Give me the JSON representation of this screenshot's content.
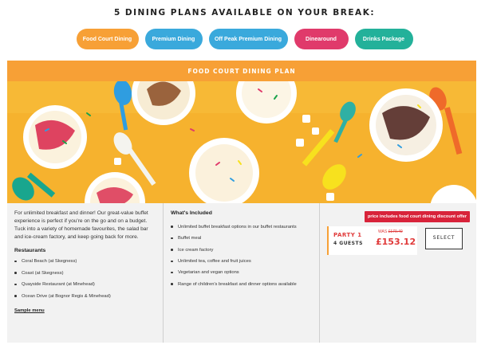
{
  "heading": "5 DINING PLANS AVAILABLE ON YOUR BREAK:",
  "plans": [
    {
      "label": "Food Court Dining",
      "color": "#f7a036"
    },
    {
      "label": "Premium Dining",
      "color": "#3aa9dc"
    },
    {
      "label": "Off Peak Premium Dining",
      "color": "#3aa9dc"
    },
    {
      "label": "Dinearound",
      "color": "#e03a6b"
    },
    {
      "label": "Drinks Package",
      "color": "#23b19a"
    }
  ],
  "banner": "FOOD COURT DINING PLAN",
  "description": "For unlimited breakfast and dinner! Our great-value buffet experience is perfect if you're on the go and on a budget. Tuck into a variety of homemade favourites, the salad bar and ice-cream factory, and keep going back for more.",
  "restaurants": {
    "title": "Restaurants",
    "items": [
      "Coral Beach (at Skegness)",
      "Coast (at Skegness)",
      "Quayside Restaurant (at Minehead)",
      "Ocean Drive (at Bognor Regis & Minehead)"
    ],
    "link": "Sample menu"
  },
  "included": {
    "title": "What's Included",
    "items": [
      "Unlimited buffet breakfast options in our buffet restaurants",
      "Buffet meal",
      "Ice cream factory",
      "Unlimited tea, coffee and fruit juices",
      "Vegetarian and vegan options",
      "Range of children's breakfast and dinner options available"
    ]
  },
  "pricing": {
    "discount_badge": "price includes food court dining discount offer",
    "party": "PARTY 1",
    "guests": "4 GUESTS",
    "was_label": "WAS",
    "was_price": "£170.40",
    "price": "£153.12",
    "select_label": "SELECT"
  },
  "colors": {
    "accent_orange": "#f7a036",
    "price_red": "#e03a3a",
    "badge_red": "#d8233a"
  }
}
